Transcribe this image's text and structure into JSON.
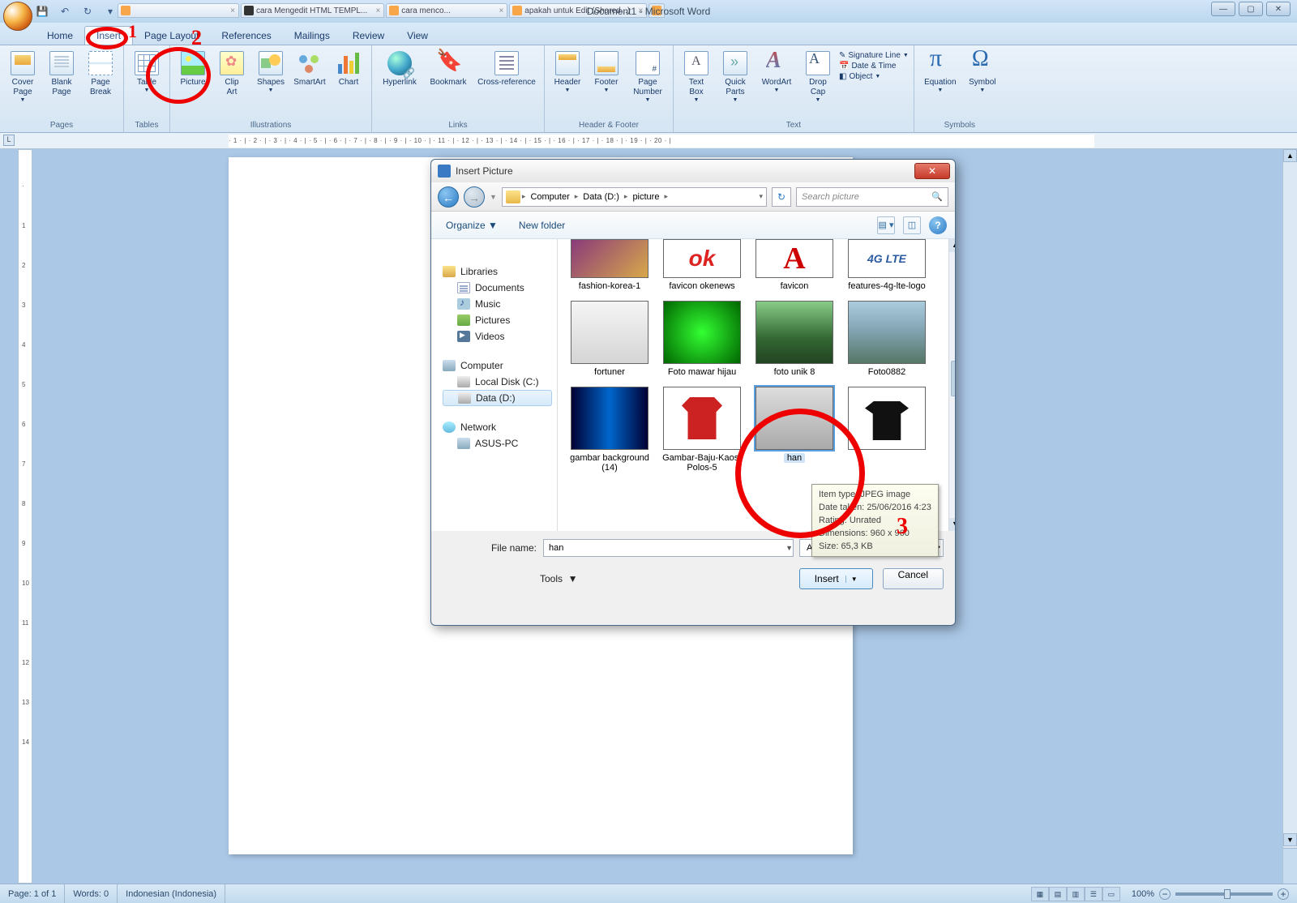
{
  "app": {
    "title": "Document1 - Microsoft Word",
    "browser_tabs": [
      "",
      "cara Mengedit HTML TEMPL...",
      "cara menco...",
      "apakah untuk Edit (Shared...)",
      "+"
    ]
  },
  "tabs": {
    "home": "Home",
    "insert": "Insert",
    "pagelayout": "Page Layout",
    "references": "References",
    "mailings": "Mailings",
    "review": "Review",
    "view": "View"
  },
  "ribbon": {
    "pages": {
      "label": "Pages",
      "cover": "Cover\nPage",
      "blank": "Blank\nPage",
      "break": "Page\nBreak"
    },
    "tables": {
      "label": "Tables",
      "table": "Table"
    },
    "illus": {
      "label": "Illustrations",
      "picture": "Picture",
      "clipart": "Clip\nArt",
      "shapes": "Shapes",
      "smartart": "SmartArt",
      "chart": "Chart"
    },
    "links": {
      "label": "Links",
      "hyperlink": "Hyperlink",
      "bookmark": "Bookmark",
      "crossref": "Cross-reference"
    },
    "hf": {
      "label": "Header & Footer",
      "header": "Header",
      "footer": "Footer",
      "pagenum": "Page\nNumber"
    },
    "text": {
      "label": "Text",
      "textbox": "Text\nBox",
      "quickparts": "Quick\nParts",
      "wordart": "WordArt",
      "dropcap": "Drop\nCap",
      "sig": "Signature Line",
      "date": "Date & Time",
      "obj": "Object"
    },
    "symbols": {
      "label": "Symbols",
      "equation": "Equation",
      "symbol": "Symbol"
    }
  },
  "ruler_h": "· 1 · | · 2 · | · 3 · | · 4 · | · 5 · | · 6 · | · 7 · | · 8 · | · 9 · | · 10 · | · 11 · | · 12 · | · 13 · | · 14 · | · 15 · | · 16 · | · 17 · | · 18 · | · 19 · | · 20 · |",
  "dialog": {
    "title": "Insert Picture",
    "breadcrumb": {
      "seg1": "Computer",
      "seg2": "Data (D:)",
      "seg3": "picture"
    },
    "search_placeholder": "Search picture",
    "organize": "Organize",
    "newfolder": "New folder",
    "nav": {
      "libraries": "Libraries",
      "documents": "Documents",
      "music": "Music",
      "pictures": "Pictures",
      "videos": "Videos",
      "computer": "Computer",
      "localc": "Local Disk (C:)",
      "datad": "Data (D:)",
      "network": "Network",
      "asuspc": "ASUS-PC"
    },
    "files": [
      "fashion-korea-1",
      "favicon okenews",
      "favicon",
      "features-4g-lte-logo",
      "fortuner",
      "Foto mawar hijau",
      "foto unik 8",
      "Foto0882",
      "gambar background (14)",
      "Gambar-Baju-Kaos-Polos-5",
      "han",
      ""
    ],
    "filename_label": "File name:",
    "filename_value": "han",
    "filter": "All Pictures",
    "tools": "Tools",
    "insert": "Insert",
    "cancel": "Cancel",
    "tooltip": {
      "l1": "Item type: JPEG image",
      "l2": "Date taken: 25/06/2016 4:23",
      "l3": "Rating: Unrated",
      "l4": "Dimensions: 960 x 960",
      "l5": "Size: 65,3 KB"
    }
  },
  "statusbar": {
    "page": "Page: 1 of 1",
    "words": "Words: 0",
    "lang": "Indonesian (Indonesia)",
    "zoom": "100%"
  },
  "misc": {
    "plus": "+",
    "minus": "−",
    "lte": "4G LTE",
    "one": "1",
    "two": "2",
    "three": "3"
  }
}
